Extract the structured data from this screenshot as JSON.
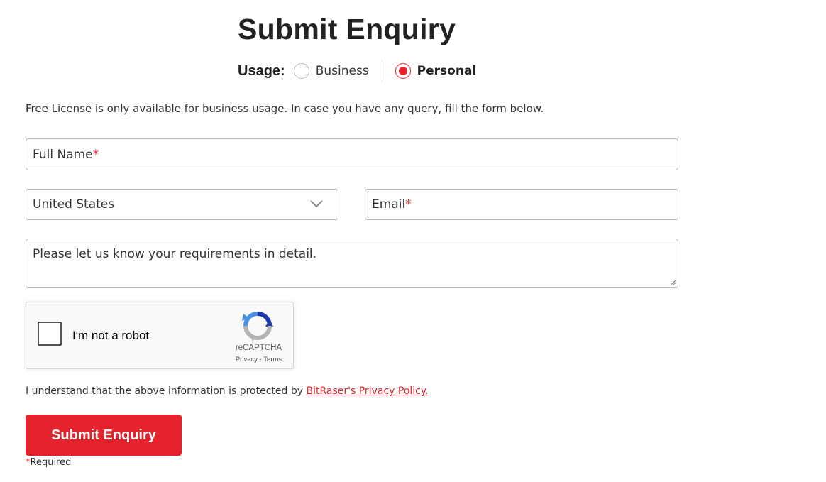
{
  "form": {
    "title": "Submit Enquiry",
    "usage": {
      "label": "Usage:",
      "options": [
        {
          "label": "Business",
          "selected": false
        },
        {
          "label": "Personal",
          "selected": true
        }
      ]
    },
    "info_text": "Free License is only available for business usage. In case you have any query, fill the form below.",
    "full_name": {
      "placeholder": "Full Name",
      "required_mark": "*"
    },
    "country": {
      "value": "United States",
      "icon": "chevron-down-icon"
    },
    "email": {
      "placeholder": "Email",
      "required_mark": "*"
    },
    "message": {
      "placeholder": "Please let us know your requirements in detail."
    },
    "recaptcha": {
      "label": "I'm not a robot",
      "brand": "reCAPTCHA",
      "privacy": "Privacy",
      "separator": " - ",
      "terms": "Terms",
      "icon": "recaptcha-logo-icon"
    },
    "privacy_notice": {
      "text": "I understand that the above information is protected by ",
      "link": "BitRaser's Privacy Policy."
    },
    "submit_label": "Submit Enquiry",
    "required_note": {
      "mark": "*",
      "text": "Required"
    }
  },
  "colors": {
    "accent": "#e3222c",
    "text": "#222222",
    "border": "#b5b5b5",
    "recaptcha_blue": "#1c3aa9",
    "recaptcha_light_blue": "#4a90e2",
    "recaptcha_gray": "#b3b3b3"
  }
}
